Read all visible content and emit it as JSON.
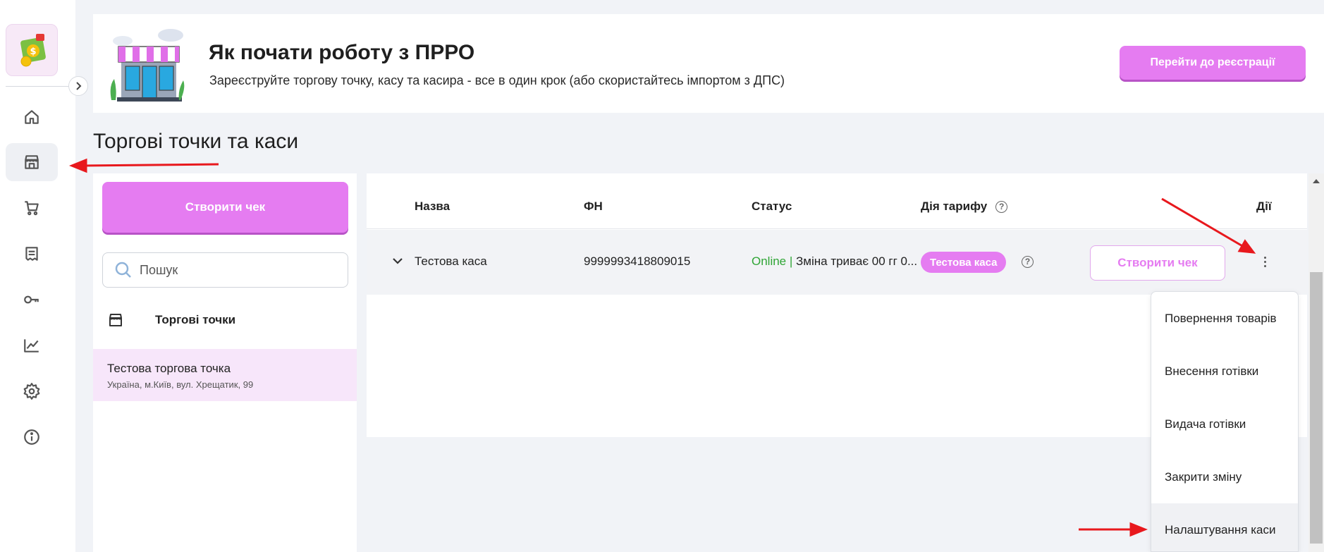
{
  "sidebar": {
    "logo_icon": "cash-register-logo",
    "collapse_icon": "chevron-right-icon",
    "items": [
      {
        "name": "home",
        "icon": "home-icon",
        "active": false
      },
      {
        "name": "stores",
        "icon": "store-icon",
        "active": true
      },
      {
        "name": "cart",
        "icon": "cart-icon",
        "active": false
      },
      {
        "name": "receipts",
        "icon": "receipt-icon",
        "active": false
      },
      {
        "name": "keys",
        "icon": "key-icon",
        "active": false
      },
      {
        "name": "analytics",
        "icon": "chart-icon",
        "active": false
      },
      {
        "name": "settings",
        "icon": "gear-icon",
        "active": false
      },
      {
        "name": "info",
        "icon": "info-icon",
        "active": false
      }
    ]
  },
  "banner": {
    "title": "Як почати роботу з ПРРО",
    "subtitle": "Зареєструйте торгову точку, касу та касира - все в один крок (або скористайтесь імпортом з ДПС)",
    "button_label": "Перейти до реєстрації"
  },
  "page": {
    "title": "Торгові точки та каси"
  },
  "left_panel": {
    "create_button_label": "Створити чек",
    "search": {
      "placeholder": "Пошук",
      "value": ""
    },
    "section_label": "Торгові точки",
    "points": [
      {
        "name": "Тестова торгова точка",
        "address": "Україна, м.Київ, вул. Хрещатик, 99"
      }
    ]
  },
  "table": {
    "headers": {
      "name": "Назва",
      "fn": "ФН",
      "status": "Статус",
      "tariff": "Дія тарифу",
      "actions": "Дії"
    },
    "help_glyph": "?",
    "rows": [
      {
        "name": "Тестова каса",
        "fn": "9999993418809015",
        "status_online": "Online",
        "status_sep": " | ",
        "status_text": "Зміна триває 00 гг 0...",
        "tariff_badge": "Тестова каса",
        "create_button_label": "Створити чек"
      }
    ]
  },
  "dropdown": {
    "items": [
      {
        "label": "Повернення товарів",
        "highlighted": false
      },
      {
        "label": "Внесення готівки",
        "highlighted": false
      },
      {
        "label": "Видача готівки",
        "highlighted": false
      },
      {
        "label": "Закрити зміну",
        "highlighted": false
      },
      {
        "label": "Налаштування каси",
        "highlighted": true
      }
    ]
  },
  "colors": {
    "accent": "#e57cf1",
    "accent_shadow": "#b853c7",
    "online": "#2fa535",
    "selected_bg": "#f7e6fa",
    "annotation_arrow": "#e8181d"
  }
}
